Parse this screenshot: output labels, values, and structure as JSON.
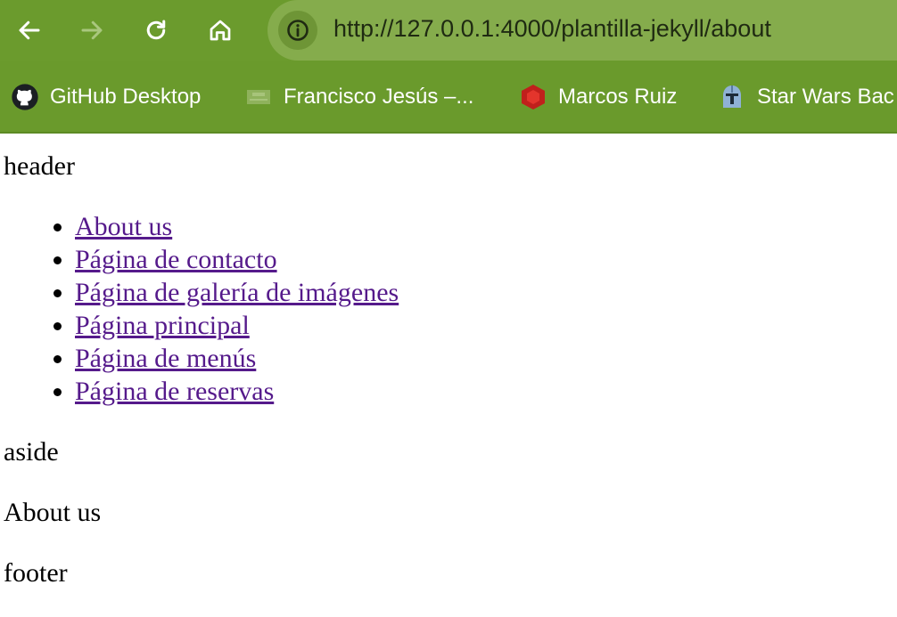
{
  "browser": {
    "url": "http://127.0.0.1:4000/plantilla-jekyll/about",
    "bookmarks": [
      {
        "label": "GitHub Desktop",
        "icon": "github-icon"
      },
      {
        "label": "Francisco Jesús –...",
        "icon": "site-thumbnail-icon"
      },
      {
        "label": "Marcos Ruiz",
        "icon": "red-hexagon-icon"
      },
      {
        "label": "Star Wars Bac",
        "icon": "mandalorian-helmet-icon"
      }
    ]
  },
  "page": {
    "header": "header",
    "nav": [
      {
        "label": "About us"
      },
      {
        "label": "Página de contacto"
      },
      {
        "label": "Página de galería de imágenes"
      },
      {
        "label": "Página principal"
      },
      {
        "label": "Página de menús"
      },
      {
        "label": "Página de reservas"
      }
    ],
    "aside": "aside",
    "main": "About us",
    "footer": "footer"
  },
  "colors": {
    "chrome": "#6b9b2d",
    "omnibox": "#85ac4c",
    "link_visited": "#551a8b"
  }
}
